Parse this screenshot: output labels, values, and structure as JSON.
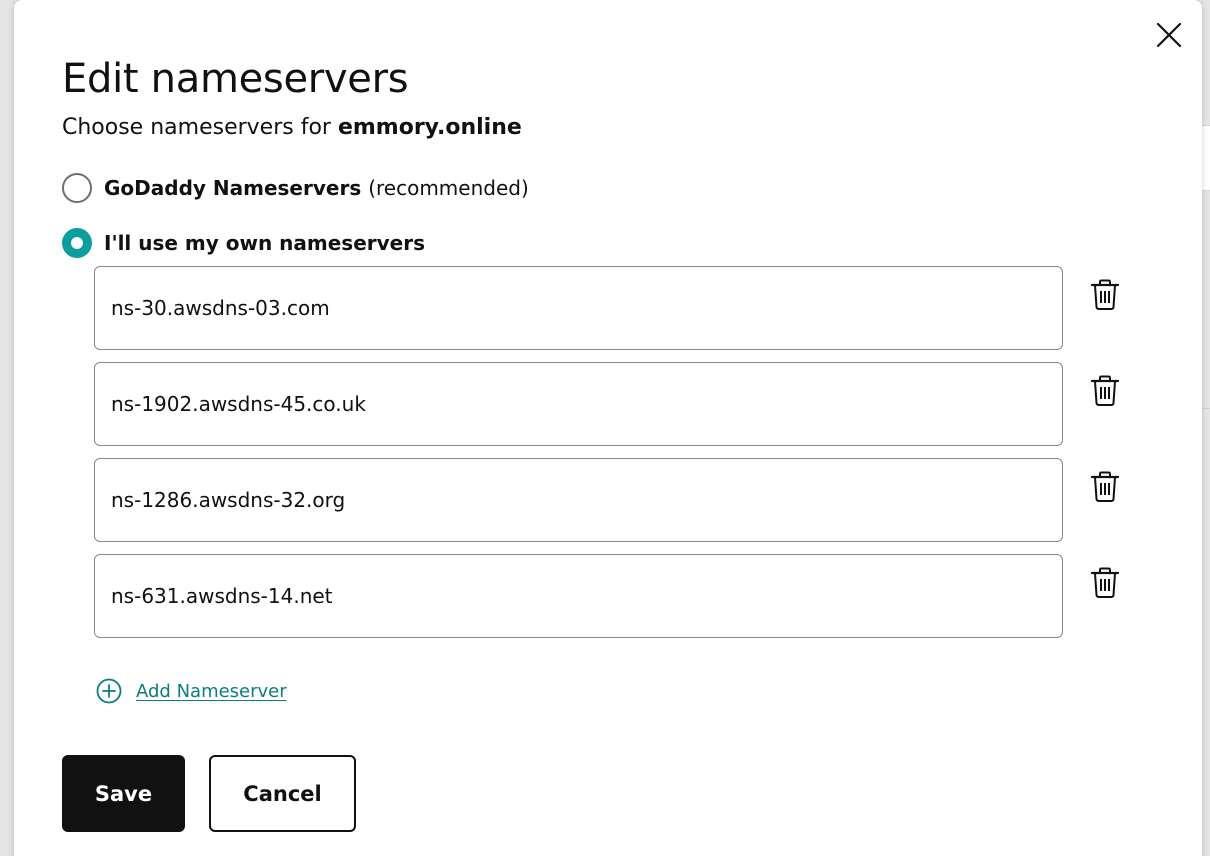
{
  "modal": {
    "title": "Edit nameservers",
    "subtitle_prefix": "Choose nameservers for",
    "domain": "emmory.online",
    "close_icon": "close-icon"
  },
  "options": {
    "godaddy": {
      "label": "GoDaddy Nameservers",
      "suffix": "(recommended)",
      "selected": false
    },
    "custom": {
      "label": "I'll use my own nameservers",
      "selected": true
    }
  },
  "nameservers": [
    {
      "value": "ns-30.awsdns-03.com",
      "delete_icon": "trash-icon"
    },
    {
      "value": "ns-1902.awsdns-45.co.uk",
      "delete_icon": "trash-icon"
    },
    {
      "value": "ns-1286.awsdns-32.org",
      "delete_icon": "trash-icon"
    },
    {
      "value": "ns-631.awsdns-14.net",
      "delete_icon": "trash-icon"
    }
  ],
  "add_nameserver": {
    "label": "Add Nameserver",
    "icon": "plus-circle-icon"
  },
  "actions": {
    "save_label": "Save",
    "cancel_label": "Cancel"
  },
  "colors": {
    "accent": "#0a9e9c",
    "link": "#0a7d7b",
    "primary_button": "#111111"
  }
}
